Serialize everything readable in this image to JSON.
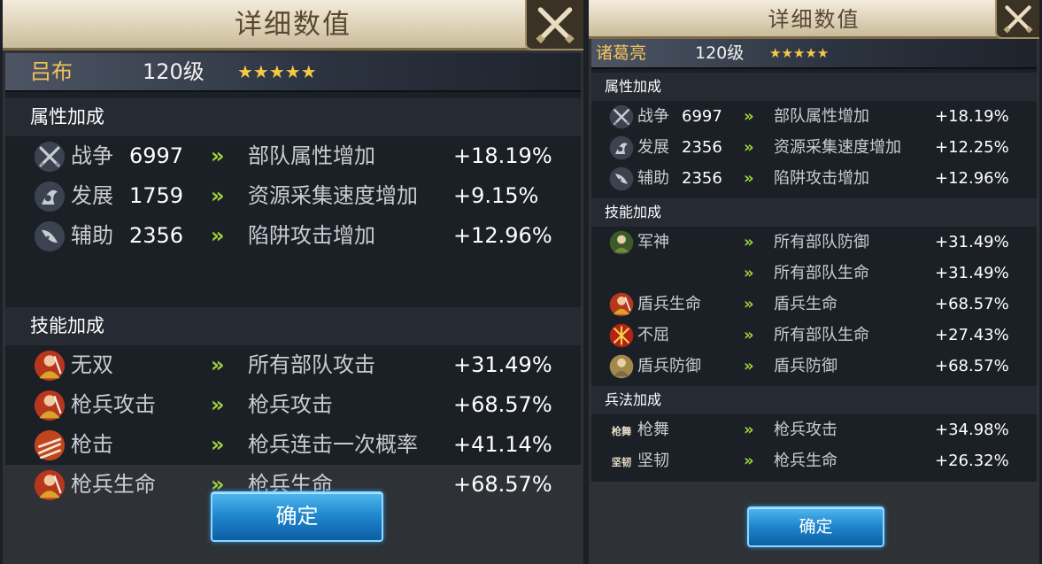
{
  "panels": [
    {
      "title": "详细数值",
      "hero": {
        "name": "吕布",
        "level": "120级",
        "stars": "★★★★★"
      },
      "sections": [
        {
          "heading": "属性加成",
          "rows": [
            {
              "icon": "crossed-swords-icon",
              "label": "战争",
              "value": "6997",
              "effect": "部队属性增加",
              "bonus": "+18.19%"
            },
            {
              "icon": "development-icon",
              "label": "发展",
              "value": "1759",
              "effect": "资源采集速度增加",
              "bonus": "+9.15%"
            },
            {
              "icon": "support-icon",
              "label": "辅助",
              "value": "2356",
              "effect": "陷阱攻击增加",
              "bonus": "+12.96%"
            }
          ]
        },
        {
          "heading": "技能加成",
          "rows": [
            {
              "icon": "skill-wushuang-icon",
              "label": "无双",
              "effect": "所有部队攻击",
              "bonus": "+31.49%"
            },
            {
              "icon": "skill-spear-attack-icon",
              "label": "枪兵攻击",
              "effect": "枪兵攻击",
              "bonus": "+68.57%"
            },
            {
              "icon": "skill-spear-strike-icon",
              "label": "枪击",
              "effect": "枪兵连击一次概率",
              "bonus": "+41.14%"
            },
            {
              "icon": "skill-spear-life-icon",
              "label": "枪兵生命",
              "effect": "枪兵生命",
              "bonus": "+68.57%"
            }
          ]
        }
      ],
      "confirm_label": "确定"
    },
    {
      "title": "详细数值",
      "hero": {
        "name": "诸葛亮",
        "level": "120级",
        "stars": "★★★★★"
      },
      "sections": [
        {
          "heading": "属性加成",
          "rows": [
            {
              "icon": "crossed-swords-icon",
              "label": "战争",
              "value": "6997",
              "effect": "部队属性增加",
              "bonus": "+18.19%"
            },
            {
              "icon": "development-icon",
              "label": "发展",
              "value": "2356",
              "effect": "资源采集速度增加",
              "bonus": "+12.25%"
            },
            {
              "icon": "support-icon",
              "label": "辅助",
              "value": "2356",
              "effect": "陷阱攻击增加",
              "bonus": "+12.96%"
            }
          ]
        },
        {
          "heading": "技能加成",
          "rows": [
            {
              "icon": "skill-junshen-icon",
              "label": "军神",
              "effect": "所有部队防御",
              "bonus": "+31.49%"
            },
            {
              "effect": "所有部队生命",
              "bonus": "+31.49%"
            },
            {
              "icon": "skill-shield-life-icon",
              "label": "盾兵生命",
              "effect": "盾兵生命",
              "bonus": "+68.57%"
            },
            {
              "icon": "skill-buqu-icon",
              "label": "不屈",
              "effect": "所有部队生命",
              "bonus": "+27.43%"
            },
            {
              "icon": "skill-shield-defense-icon",
              "label": "盾兵防御",
              "effect": "盾兵防御",
              "bonus": "+68.57%"
            }
          ]
        },
        {
          "heading": "兵法加成",
          "rows": [
            {
              "icon": "tactic-qiangwu-icon",
              "icon_text": "枪舞",
              "label": "枪舞",
              "effect": "枪兵攻击",
              "bonus": "+34.98%"
            },
            {
              "icon": "tactic-jianren-icon",
              "icon_text": "坚韧",
              "label": "坚韧",
              "effect": "枪兵生命",
              "bonus": "+26.32%"
            }
          ]
        }
      ],
      "confirm_label": "确定"
    }
  ]
}
